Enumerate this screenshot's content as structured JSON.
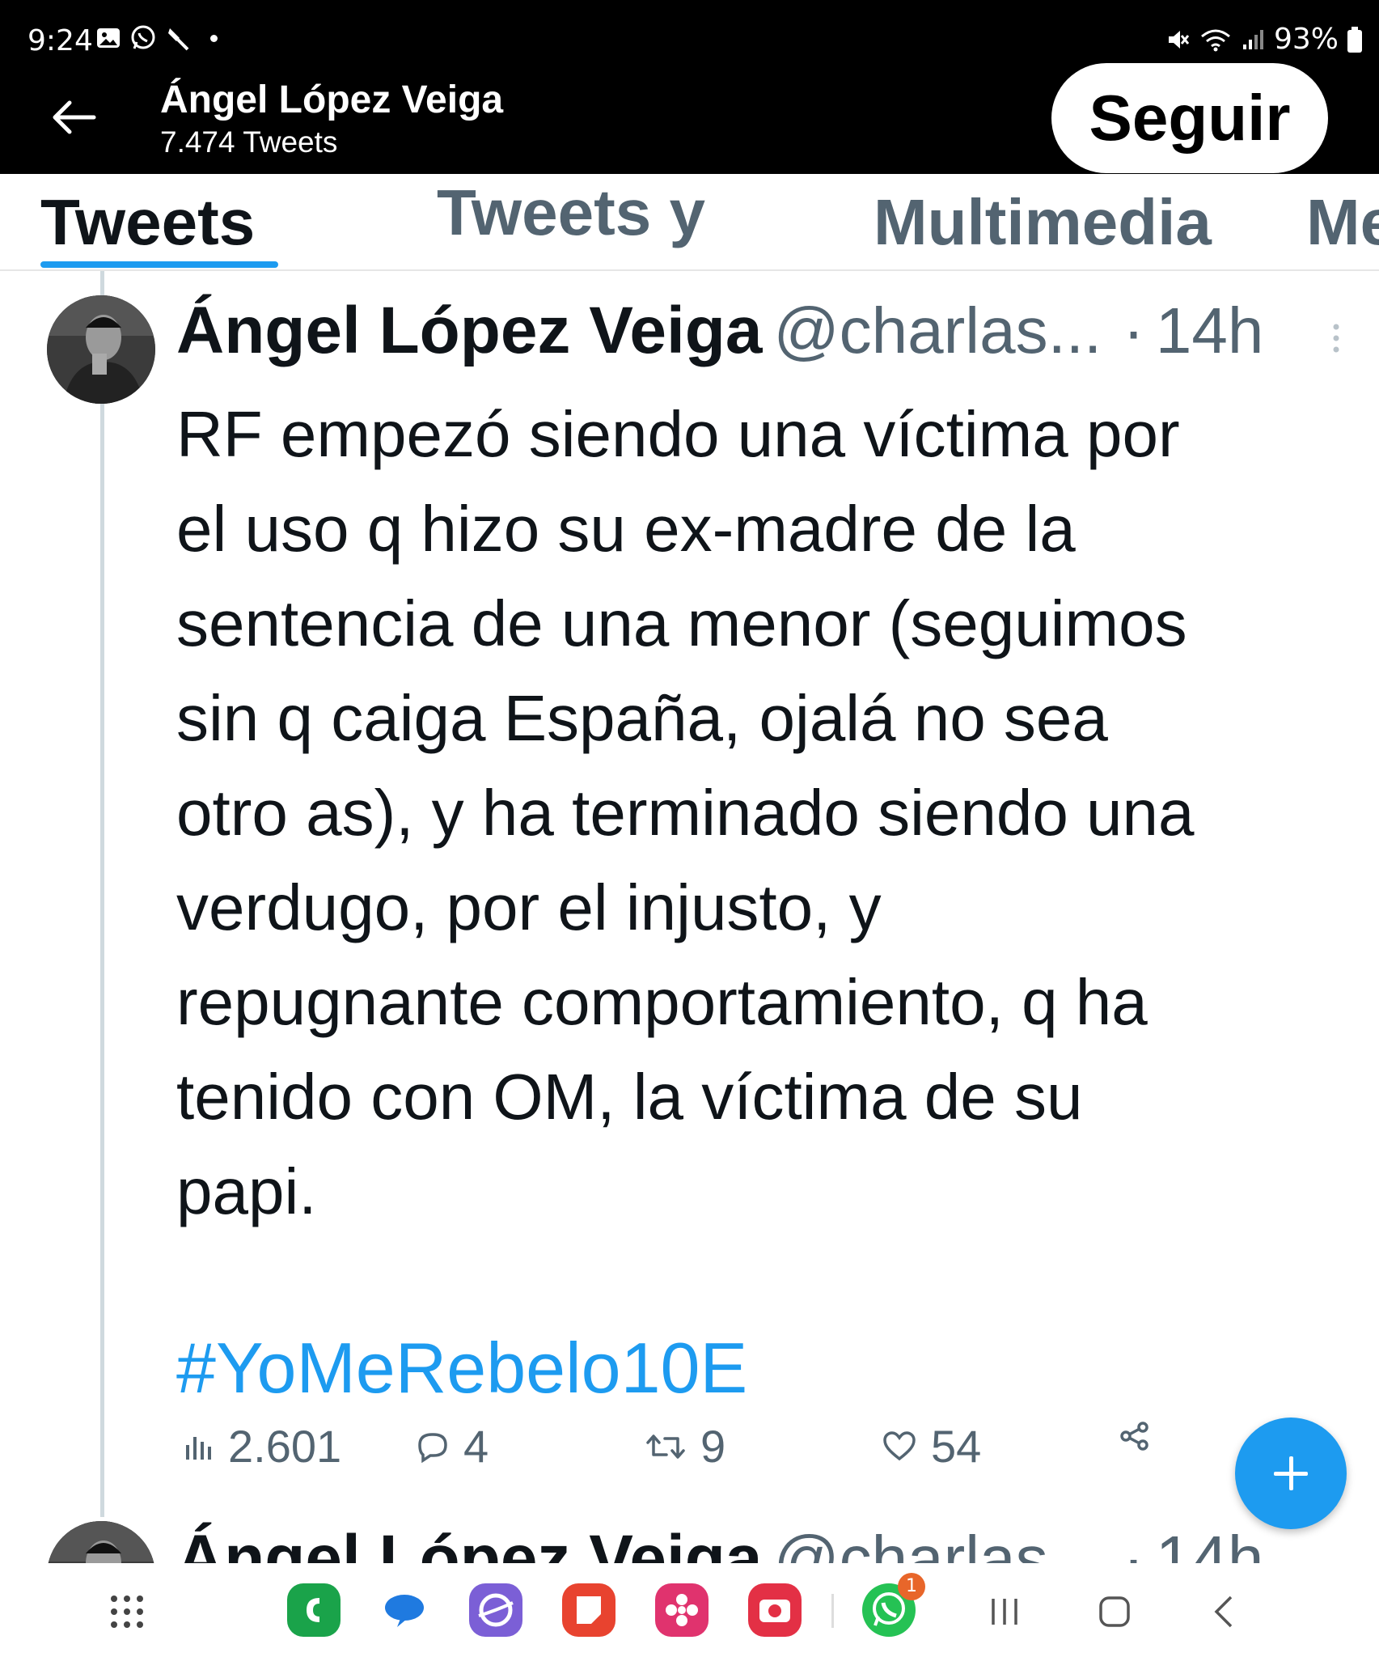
{
  "status_bar": {
    "time": "9:24",
    "battery": "93%"
  },
  "header": {
    "name": "Ángel López Veiga",
    "tweet_count": "7.474 Tweets",
    "follow_label": "Seguir"
  },
  "tabs": [
    {
      "label": "Tweets",
      "active": true
    },
    {
      "label": "Tweets y",
      "active": false
    },
    {
      "label": "Multimedia",
      "active": false
    },
    {
      "label": "Me",
      "active": false
    }
  ],
  "tweet": {
    "name": "Ángel López Veiga",
    "handle": "@charlas...",
    "separator": "·",
    "time": "14h",
    "text_lines": [
      "RF empezó siendo una víctima por",
      "el uso q hizo su ex-madre de la",
      "sentencia de una menor (seguimos",
      "sin q caiga España, ojalá no sea",
      "otro as), y ha terminado siendo una",
      "verdugo, por el injusto, y",
      "repugnante comportamiento, q ha",
      "tenido con OM, la víctima de su",
      "papi."
    ],
    "hashtag": "#YoMeRebelo10E",
    "views": "2.601",
    "replies": "4",
    "retweets": "9",
    "likes": "54"
  },
  "next_tweet": {
    "name": "Ángel López Veiga",
    "handle": "@charlas...",
    "separator": "·",
    "time": "14h"
  },
  "nav_bar": {
    "whatsapp_badge": "1"
  },
  "colors": {
    "accent": "#1d9bf0",
    "secondary_text": "#536471",
    "primary_text": "#0f1419"
  }
}
